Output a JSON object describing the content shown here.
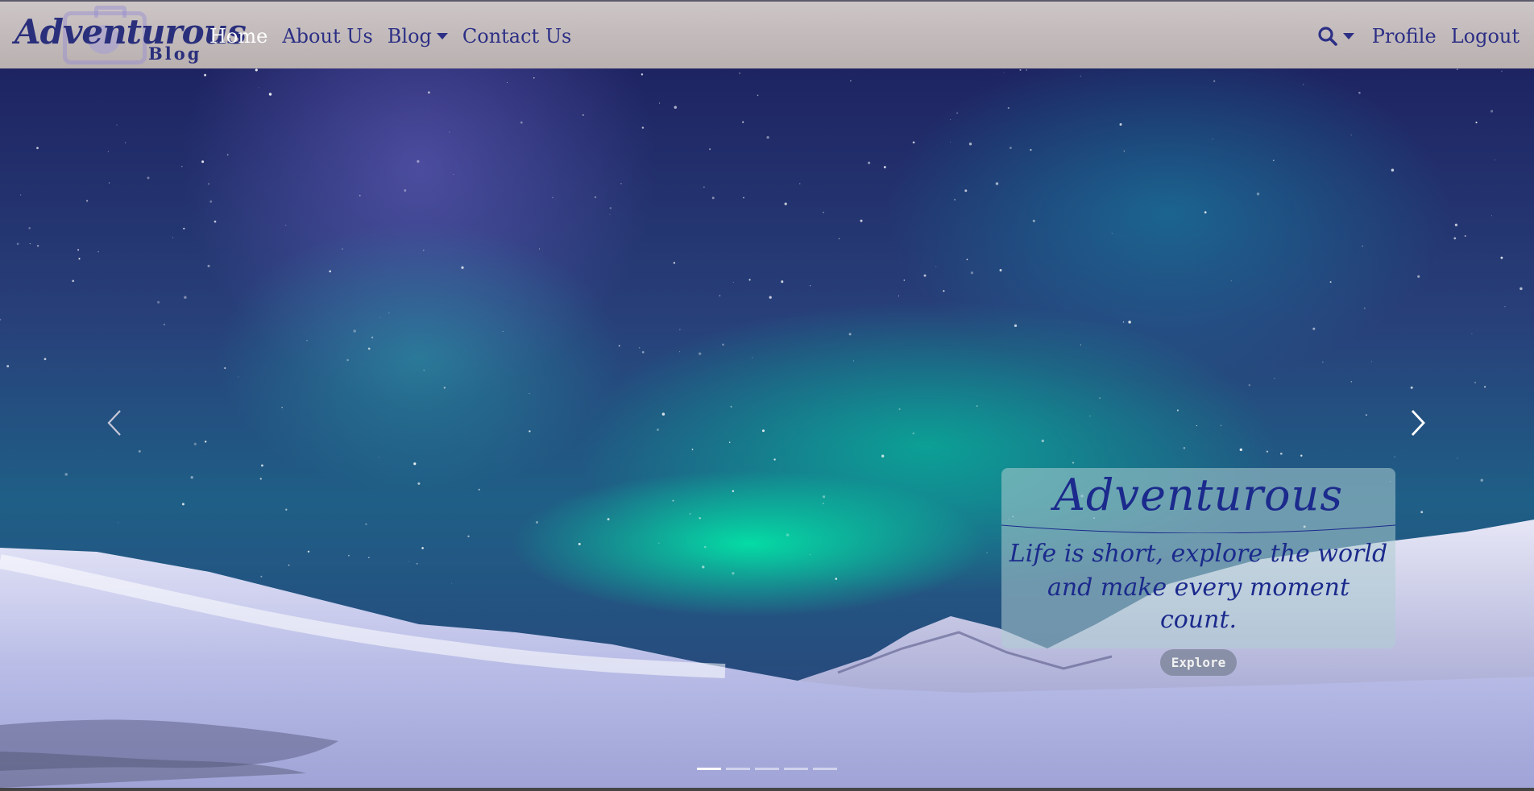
{
  "navbar": {
    "brand": {
      "main": "Adventurous",
      "sub": "Blog"
    },
    "left_links": [
      {
        "label": "Home",
        "active": true
      },
      {
        "label": "About Us",
        "active": false
      },
      {
        "label": "Blog",
        "active": false,
        "dropdown": true
      },
      {
        "label": "Contact Us",
        "active": false
      }
    ],
    "search_icon": "search-icon",
    "right_links": [
      {
        "label": "Profile"
      },
      {
        "label": "Logout"
      }
    ],
    "colors": {
      "link": "#2c2f85",
      "active_link": "#ffffff",
      "bar": "#c6bebe"
    }
  },
  "carousel": {
    "prev_icon": "chevron-left-icon",
    "next_icon": "chevron-right-icon",
    "caption": {
      "title": "Adventurous",
      "text_line1": "Life is short, explore the world",
      "text_line2": "and make every moment count.",
      "button": "Explore"
    },
    "slide_count": 5,
    "active_index": 0,
    "colors": {
      "caption_text": "#1b2a8c"
    }
  }
}
